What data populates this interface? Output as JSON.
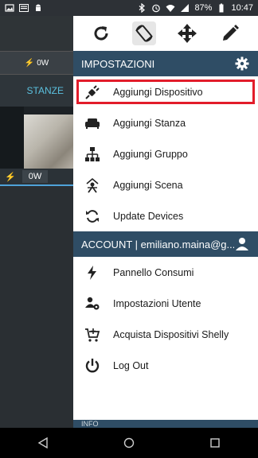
{
  "status_bar": {
    "time": "10:47",
    "battery": "87%",
    "notifications": [
      "image-icon",
      "ilfatto-icon",
      "android-icon"
    ],
    "indicators": [
      "bluetooth-icon",
      "alarm-icon",
      "wifi-icon",
      "signal-icon",
      "battery-icon"
    ]
  },
  "background_app": {
    "power_value": "0W",
    "tab_label": "STANZE",
    "room_power": "0W"
  },
  "drawer": {
    "top_icons": [
      "refresh-icon",
      "screen-rotate-icon",
      "move-icon",
      "edit-icon"
    ],
    "settings_section": {
      "title": "IMPOSTAZIONI",
      "items": [
        {
          "label": "Aggiungi Dispositivo",
          "icon": "plug-icon"
        },
        {
          "label": "Aggiungi Stanza",
          "icon": "sofa-icon"
        },
        {
          "label": "Aggiungi Gruppo",
          "icon": "group-icon"
        },
        {
          "label": "Aggiungi Scena",
          "icon": "scene-icon"
        },
        {
          "label": "Update Devices",
          "icon": "sync-icon"
        }
      ]
    },
    "account_section": {
      "title": "ACCOUNT | emiliano.maina@g...",
      "items": [
        {
          "label": "Pannello Consumi",
          "icon": "bolt-icon"
        },
        {
          "label": "Impostazioni Utente",
          "icon": "user-settings-icon"
        },
        {
          "label": "Acquista Dispositivi Shelly",
          "icon": "cart-icon"
        },
        {
          "label": "Log Out",
          "icon": "power-icon"
        }
      ]
    },
    "info_section": {
      "title": "INFO"
    }
  },
  "colors": {
    "section_header": "#2f4d65",
    "highlight_border": "#e21c2a",
    "accent": "#5bc0de"
  }
}
